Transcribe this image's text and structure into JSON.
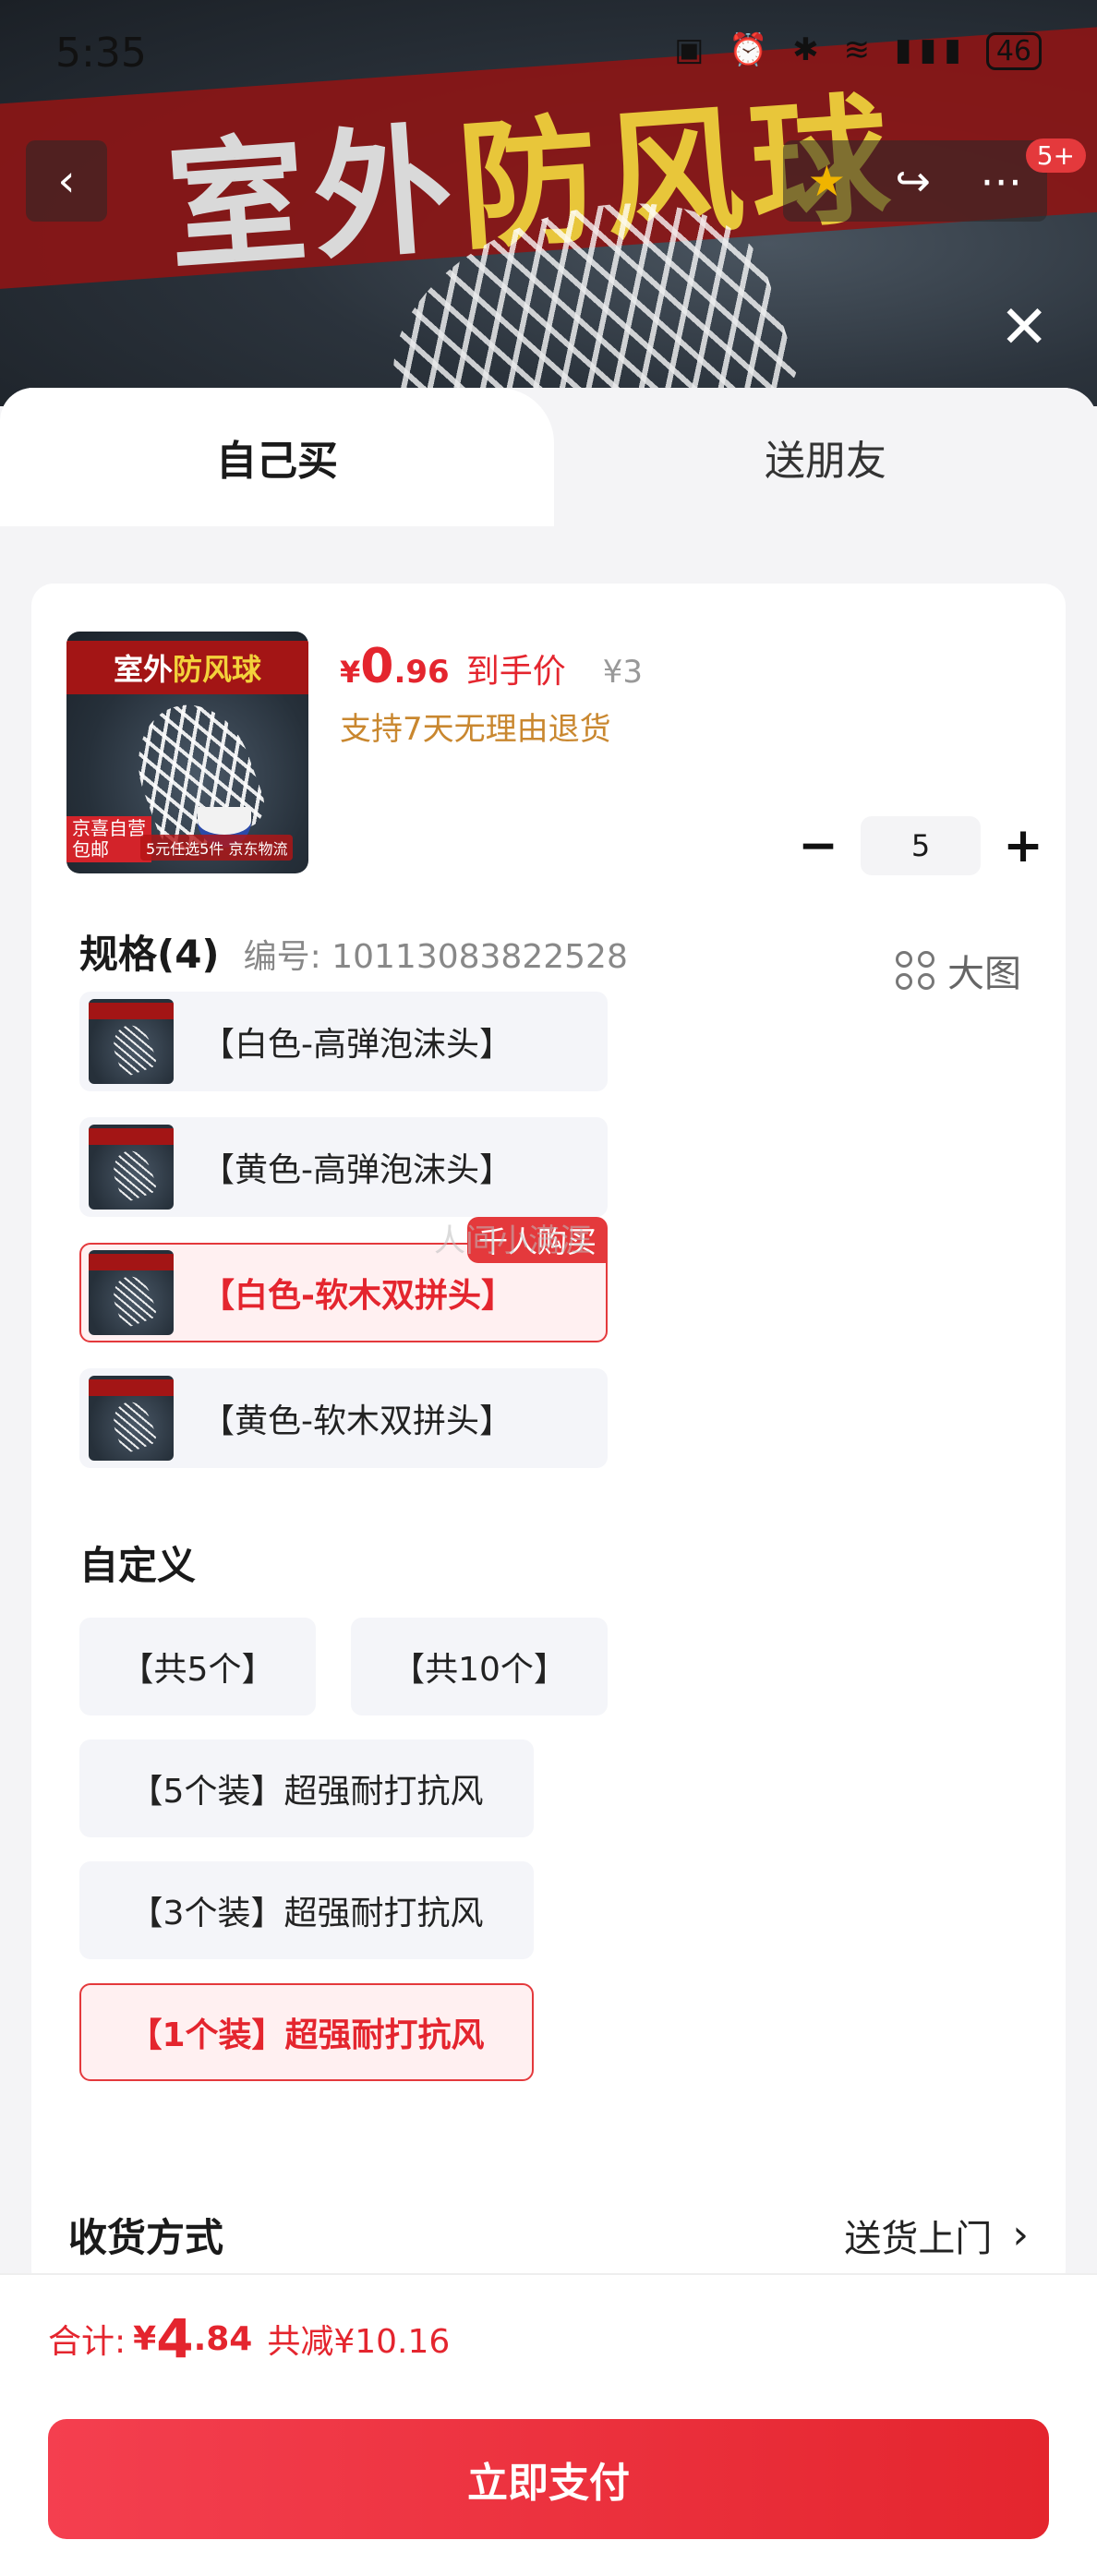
{
  "status_bar": {
    "time": "5:35",
    "battery": "46"
  },
  "banner": {
    "title_part1": "室外",
    "title_part2": "防风球"
  },
  "nav": {
    "back_icon": "‹",
    "star_icon": "★",
    "share_icon": "↪",
    "more_icon": "⋯",
    "badge": "5+",
    "close_icon": "✕"
  },
  "tabs": {
    "self": "自己买",
    "gift": "送朋友"
  },
  "product": {
    "img_title_1": "室外",
    "img_title_2": "防风球",
    "img_tag": "京喜自营\n包邮",
    "img_foot": "5元任选5件 京东物流",
    "price_symbol": "¥",
    "price_int": "0",
    "price_dec": ".96",
    "price_label": "到手价",
    "orig_price": "¥3",
    "return_policy": "支持7天无理由退货",
    "quantity": "5"
  },
  "spec": {
    "title": "规格(4)",
    "code": "编号: 10113083822528",
    "big_image_label": "大图",
    "options": [
      {
        "label": "【白色-高弹泡沫头】"
      },
      {
        "label": "【黄色-高弹泡沫头】"
      },
      {
        "label": "【白色-软木双拼头】",
        "badge": "千人购买"
      },
      {
        "label": "【黄色-软木双拼头】"
      }
    ]
  },
  "custom": {
    "title": "自定义",
    "options": [
      {
        "label": "【共5个】"
      },
      {
        "label": "【共10个】"
      },
      {
        "label": "【5个装】超强耐打抗风"
      },
      {
        "label": "【3个装】超强耐打抗风"
      },
      {
        "label": "【1个装】超强耐打抗风"
      }
    ]
  },
  "delivery": {
    "title": "收货方式",
    "value": "送货上门",
    "chevron": "›"
  },
  "summary": {
    "label": "合计:",
    "symbol": "¥",
    "int": "4",
    "dec": ".84",
    "discount": "共减¥10.16"
  },
  "pay_button": "立即支付",
  "watermark": "人间小满涯",
  "colors": {
    "accent": "#e4252e",
    "gold": "#c9872f",
    "chip_bg": "#f4f5f9"
  }
}
